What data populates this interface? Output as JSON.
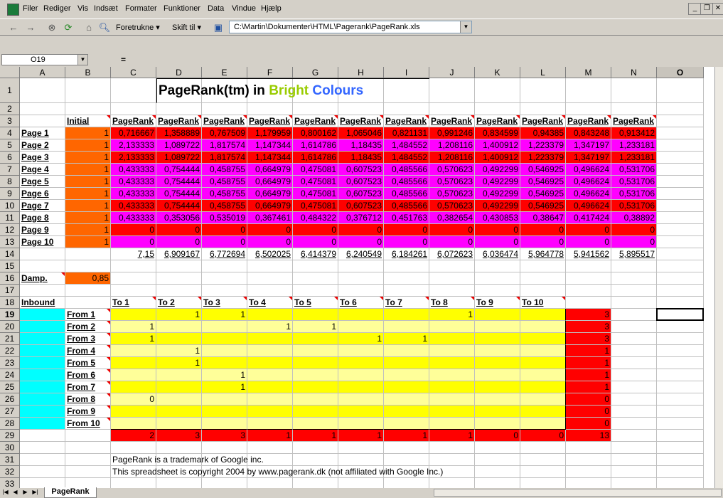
{
  "menu": [
    "Filer",
    "Rediger",
    "Vis",
    "Indsæt",
    "Formater",
    "Funktioner",
    "Data",
    "Vindue",
    "Hjælp"
  ],
  "toolbar": {
    "favorites": "Foretrukne",
    "goto": "Skift til",
    "address": "C:\\Martin\\Dokumenter\\HTML\\Pagerank\\PageRank.xls"
  },
  "namebox": "O19",
  "formula_sign": "=",
  "columns": [
    "A",
    "B",
    "C",
    "D",
    "E",
    "F",
    "G",
    "H",
    "I",
    "J",
    "K",
    "L",
    "M",
    "N",
    "O"
  ],
  "rows": [
    "1",
    "2",
    "3",
    "4",
    "5",
    "6",
    "7",
    "8",
    "9",
    "10",
    "11",
    "12",
    "13",
    "14",
    "15",
    "16",
    "17",
    "18",
    "19",
    "20",
    "21",
    "22",
    "23",
    "24",
    "25",
    "26",
    "27",
    "28",
    "29",
    "30",
    "31",
    "32",
    "33"
  ],
  "title": {
    "part1": "PageRank(tm) in ",
    "part2": "Bright",
    "part3": " Colours"
  },
  "initial_label": "Initial",
  "pr_headers": [
    "PageRank",
    "PageRank",
    "PageRank",
    "PageRank",
    "PageRank",
    "PageRank",
    "PageRank",
    "PageRank",
    "PageRank",
    "PageRank",
    "PageRank",
    "PageRank"
  ],
  "pages": [
    "Page 1",
    "Page 2",
    "Page 3",
    "Page 4",
    "Page 5",
    "Page 6",
    "Page 7",
    "Page 8",
    "Page 9",
    "Page 10"
  ],
  "initial_values": [
    "1",
    "1",
    "1",
    "1",
    "1",
    "1",
    "1",
    "1",
    "1",
    "1"
  ],
  "pr_values": [
    [
      "0,716667",
      "1,358889",
      "0,767509",
      "1,179959",
      "0,800162",
      "1,065046",
      "0,821131",
      "0,991246",
      "0,834599",
      "0,94385",
      "0,843248",
      "0,913412"
    ],
    [
      "2,133333",
      "1,089722",
      "1,817574",
      "1,147344",
      "1,614786",
      "1,18435",
      "1,484552",
      "1,208116",
      "1,400912",
      "1,223379",
      "1,347197",
      "1,233181"
    ],
    [
      "2,133333",
      "1,089722",
      "1,817574",
      "1,147344",
      "1,614786",
      "1,18435",
      "1,484552",
      "1,208116",
      "1,400912",
      "1,223379",
      "1,347197",
      "1,233181"
    ],
    [
      "0,433333",
      "0,754444",
      "0,458755",
      "0,664979",
      "0,475081",
      "0,607523",
      "0,485566",
      "0,570623",
      "0,492299",
      "0,546925",
      "0,496624",
      "0,531706"
    ],
    [
      "0,433333",
      "0,754444",
      "0,458755",
      "0,664979",
      "0,475081",
      "0,607523",
      "0,485566",
      "0,570623",
      "0,492299",
      "0,546925",
      "0,496624",
      "0,531706"
    ],
    [
      "0,433333",
      "0,754444",
      "0,458755",
      "0,664979",
      "0,475081",
      "0,607523",
      "0,485566",
      "0,570623",
      "0,492299",
      "0,546925",
      "0,496624",
      "0,531706"
    ],
    [
      "0,433333",
      "0,754444",
      "0,458755",
      "0,664979",
      "0,475081",
      "0,607523",
      "0,485566",
      "0,570623",
      "0,492299",
      "0,546925",
      "0,496624",
      "0,531706"
    ],
    [
      "0,433333",
      "0,353056",
      "0,535019",
      "0,367461",
      "0,484322",
      "0,376712",
      "0,451763",
      "0,382654",
      "0,430853",
      "0,38647",
      "0,417424",
      "0,38892"
    ],
    [
      "0",
      "0",
      "0",
      "0",
      "0",
      "0",
      "0",
      "0",
      "0",
      "0",
      "0",
      "0"
    ],
    [
      "0",
      "0",
      "0",
      "0",
      "0",
      "0",
      "0",
      "0",
      "0",
      "0",
      "0",
      "0"
    ]
  ],
  "row14_sums": [
    "7,15",
    "6,909167",
    "6,772694",
    "6,502025",
    "6,414379",
    "6,240549",
    "6,184261",
    "6,072623",
    "6,036474",
    "5,964778",
    "5,941562",
    "5,895517"
  ],
  "damp": {
    "label": "Damp.",
    "value": "0,85"
  },
  "inbound_label": "Inbound",
  "to_headers": [
    "To 1",
    "To 2",
    "To 3",
    "To 4",
    "To 5",
    "To 6",
    "To 7",
    "To 8",
    "To 9",
    "To 10"
  ],
  "from_labels": [
    "From 1",
    "From 2",
    "From 3",
    "From 4",
    "From 5",
    "From 6",
    "From 7",
    "From 8",
    "From 9",
    "From 10"
  ],
  "matrix": [
    [
      "",
      "1",
      "1",
      "",
      "",
      "",
      "",
      "1",
      "",
      ""
    ],
    [
      "1",
      "",
      "",
      "1",
      "1",
      "",
      "",
      "",
      "",
      ""
    ],
    [
      "1",
      "",
      "",
      "",
      "",
      "1",
      "1",
      "",
      "",
      ""
    ],
    [
      "",
      "1",
      "",
      "",
      "",
      "",
      "",
      "",
      "",
      ""
    ],
    [
      "",
      "1",
      "",
      "",
      "",
      "",
      "",
      "",
      "",
      ""
    ],
    [
      "",
      "",
      "1",
      "",
      "",
      "",
      "",
      "",
      "",
      ""
    ],
    [
      "",
      "",
      "1",
      "",
      "",
      "",
      "",
      "",
      "",
      ""
    ],
    [
      "0",
      "",
      "",
      "",
      "",
      "",
      "",
      "",
      "",
      ""
    ],
    [
      "",
      "",
      "",
      "",
      "",
      "",
      "",
      "",
      "",
      ""
    ],
    [
      "",
      "",
      "",
      "",
      "",
      "",
      "",
      "",
      "",
      ""
    ]
  ],
  "outbound_counts": [
    "3",
    "3",
    "3",
    "1",
    "1",
    "1",
    "1",
    "0",
    "0",
    "0"
  ],
  "col_totals": [
    "2",
    "3",
    "3",
    "1",
    "1",
    "1",
    "1",
    "1",
    "0",
    "0"
  ],
  "grand_total": "13",
  "footer": {
    "line1": "PageRank is a trademark of Google inc.",
    "line2": "This spreadsheet is copyright 2004 by www.pagerank.dk (not affiliated with Google Inc.)"
  },
  "sheet_tab": "PageRank",
  "colors": {
    "orange": "#ff6600",
    "red": "#ff0000",
    "magenta": "#ff00ff",
    "cyan": "#00ffff",
    "yellow": "#ffff00",
    "pale_yellow": "#ffff99",
    "green": "#99cc00",
    "blue": "#3366ff"
  }
}
